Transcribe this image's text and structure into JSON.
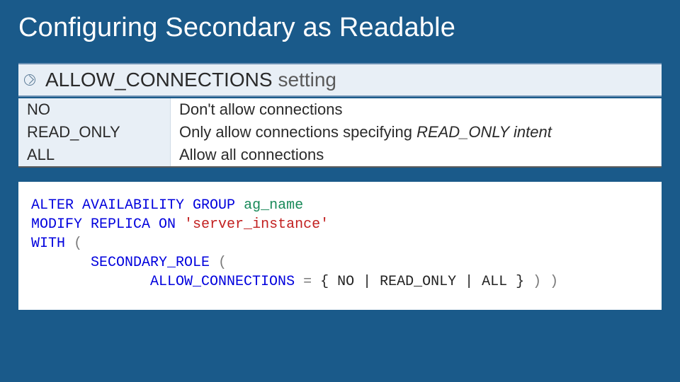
{
  "title": "Configuring Secondary as Readable",
  "section": {
    "label": "ALLOW_CONNECTIONS",
    "suffix": "setting"
  },
  "table": {
    "rows": [
      {
        "k": "NO",
        "v_pre": "Don't allow connections",
        "v_em": "",
        "v_post": ""
      },
      {
        "k": "READ_ONLY",
        "v_pre": "Only allow connections specifying ",
        "v_em": "READ_ONLY intent",
        "v_post": ""
      },
      {
        "k": "ALL",
        "v_pre": "Allow all connections",
        "v_em": "",
        "v_post": ""
      }
    ]
  },
  "code": {
    "l1a": "ALTER AVAILABILITY GROUP ",
    "l1b": "ag_name",
    "l2a": "MODIFY REPLICA ON ",
    "l2b": "'server_instance'",
    "l3a": "WITH ",
    "l3b": "(",
    "l4i": "       ",
    "l4a": "SECONDARY_ROLE ",
    "l4b": "(",
    "l5i": "              ",
    "l5a": "ALLOW_CONNECTIONS ",
    "l5eq": "=",
    "l5sp1": " ",
    "l5b": "{ NO | READ_ONLY | ALL }",
    "l5sp2": " ",
    "l5c": ") )"
  }
}
